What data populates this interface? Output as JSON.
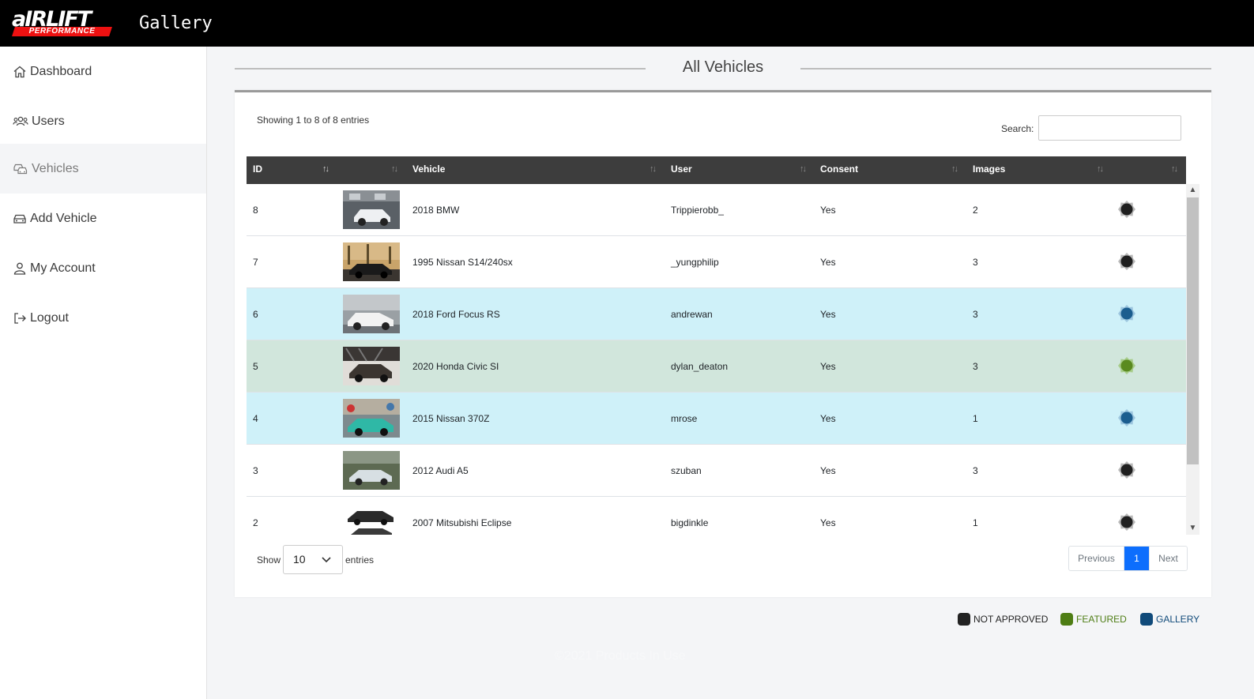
{
  "header": {
    "logo_main": "aIRLIFT",
    "logo_sub": "PERFORMANCE",
    "app_title": "Gallery"
  },
  "sidebar": {
    "items": [
      {
        "label": "Dashboard",
        "icon": "home-icon"
      },
      {
        "label": "Users",
        "icon": "users-icon"
      },
      {
        "label": "Vehicles",
        "icon": "cars-icon",
        "active": true
      },
      {
        "label": "Add Vehicle",
        "icon": "car-icon"
      },
      {
        "label": "My Account",
        "icon": "user-icon"
      },
      {
        "label": "Logout",
        "icon": "logout-icon"
      }
    ]
  },
  "main": {
    "title": "All Vehicles",
    "info": "Showing 1 to 8 of 8 entries",
    "search_label": "Search:",
    "search_value": "",
    "columns": [
      "ID",
      "",
      "Vehicle",
      "User",
      "Consent",
      "Images",
      ""
    ],
    "rows": [
      {
        "id": "8",
        "vehicle": "2018 BMW",
        "user": "Trippierobb_",
        "consent": "Yes",
        "images": "2",
        "status": "not-approved"
      },
      {
        "id": "7",
        "vehicle": "1995 Nissan S14/240sx",
        "user": "_yungphilip",
        "consent": "Yes",
        "images": "3",
        "status": "not-approved"
      },
      {
        "id": "6",
        "vehicle": "2018 Ford Focus RS",
        "user": "andrewan",
        "consent": "Yes",
        "images": "3",
        "status": "gallery"
      },
      {
        "id": "5",
        "vehicle": "2020 Honda Civic SI",
        "user": "dylan_deaton",
        "consent": "Yes",
        "images": "3",
        "status": "featured"
      },
      {
        "id": "4",
        "vehicle": "2015 Nissan 370Z",
        "user": "mrose",
        "consent": "Yes",
        "images": "1",
        "status": "gallery"
      },
      {
        "id": "3",
        "vehicle": "2012 Audi A5",
        "user": "szuban",
        "consent": "Yes",
        "images": "3",
        "status": "not-approved"
      },
      {
        "id": "2",
        "vehicle": "2007 Mitsubishi Eclipse",
        "user": "bigdinkle",
        "consent": "Yes",
        "images": "1",
        "status": "not-approved"
      }
    ],
    "show_label": "Show",
    "page_length": "10",
    "entries_label": "entries",
    "pagination": {
      "previous": "Previous",
      "current": "1",
      "next": "Next"
    }
  },
  "legend": [
    {
      "label": "NOT APPROVED",
      "color": "#222222"
    },
    {
      "label": "FEATURED",
      "color": "#4e7d14"
    },
    {
      "label": "GALLERY",
      "color": "#104a7a"
    }
  ],
  "status_colors": {
    "not-approved": "#1f1f1f",
    "featured": "#5a8a1f",
    "gallery": "#1b5d8f"
  },
  "footer": "©2021 Products In Use"
}
